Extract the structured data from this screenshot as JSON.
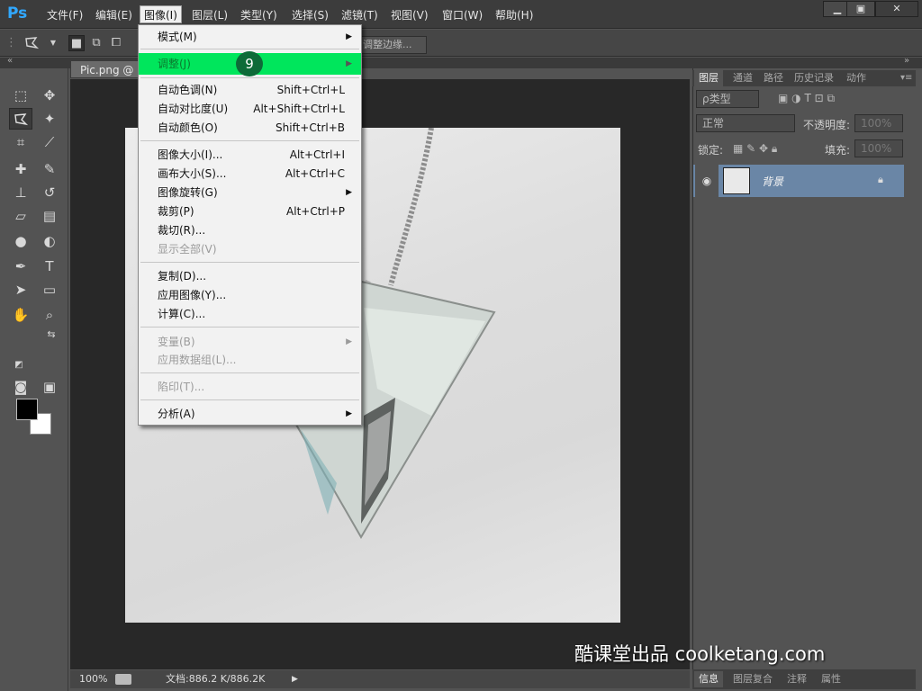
{
  "menubar": {
    "logo": "Ps",
    "items": [
      {
        "label": "文件(F)"
      },
      {
        "label": "编辑(E)"
      },
      {
        "label": "图像(I)"
      },
      {
        "label": "图层(L)"
      },
      {
        "label": "类型(Y)"
      },
      {
        "label": "选择(S)"
      },
      {
        "label": "滤镜(T)"
      },
      {
        "label": "视图(V)"
      },
      {
        "label": "窗口(W)"
      },
      {
        "label": "帮助(H)"
      }
    ],
    "window_buttons": {
      "minimize": "▁",
      "restore": "▣",
      "close": "✕"
    }
  },
  "options_bar": {
    "refine_edge_label": "调整边缘..."
  },
  "document": {
    "tab_title": "Pic.png @ 1",
    "zoom": "100%",
    "doc_info": "文档:886.2 K/886.2K"
  },
  "image_menu": {
    "items": [
      {
        "label": "模式(M)",
        "shortcut": "",
        "submenu": true,
        "disabled": false
      },
      {
        "label": "调整(J)",
        "shortcut": "",
        "submenu": true,
        "disabled": false,
        "highlight": true
      },
      {
        "label": "自动色调(N)",
        "shortcut": "Shift+Ctrl+L"
      },
      {
        "label": "自动对比度(U)",
        "shortcut": "Alt+Shift+Ctrl+L"
      },
      {
        "label": "自动颜色(O)",
        "shortcut": "Shift+Ctrl+B"
      },
      {
        "label": "图像大小(I)...",
        "shortcut": "Alt+Ctrl+I"
      },
      {
        "label": "画布大小(S)...",
        "shortcut": "Alt+Ctrl+C"
      },
      {
        "label": "图像旋转(G)",
        "shortcut": "",
        "submenu": true
      },
      {
        "label": "裁剪(P)",
        "shortcut": "Alt+Ctrl+P"
      },
      {
        "label": "裁切(R)...",
        "shortcut": ""
      },
      {
        "label": "显示全部(V)",
        "shortcut": "",
        "disabled": true
      },
      {
        "label": "复制(D)...",
        "shortcut": ""
      },
      {
        "label": "应用图像(Y)...",
        "shortcut": ""
      },
      {
        "label": "计算(C)...",
        "shortcut": ""
      },
      {
        "label": "变量(B)",
        "shortcut": "",
        "submenu": true,
        "disabled": true
      },
      {
        "label": "应用数据组(L)...",
        "shortcut": "",
        "disabled": true
      },
      {
        "label": "陷印(T)...",
        "shortcut": "",
        "disabled": true
      },
      {
        "label": "分析(A)",
        "shortcut": "",
        "submenu": true
      }
    ],
    "step_badge": "9"
  },
  "layers_panel": {
    "tabs": [
      "图层",
      "通道",
      "路径",
      "历史记录",
      "动作"
    ],
    "filter_type": "ρ类型",
    "blend_mode": "正常",
    "opacity_label": "不透明度:",
    "opacity_value": "100%",
    "lock_label": "锁定:",
    "fill_label": "填充:",
    "fill_value": "100%",
    "layer_name": "背景"
  },
  "bottom_tabs": [
    "信息",
    "图层复合",
    "注释",
    "属性"
  ],
  "watermark": "酷课堂出品 coolketang.com",
  "colors": {
    "highlight": "#00e65c",
    "layer_selected": "#6a86a6",
    "logo": "#31a8ff"
  }
}
